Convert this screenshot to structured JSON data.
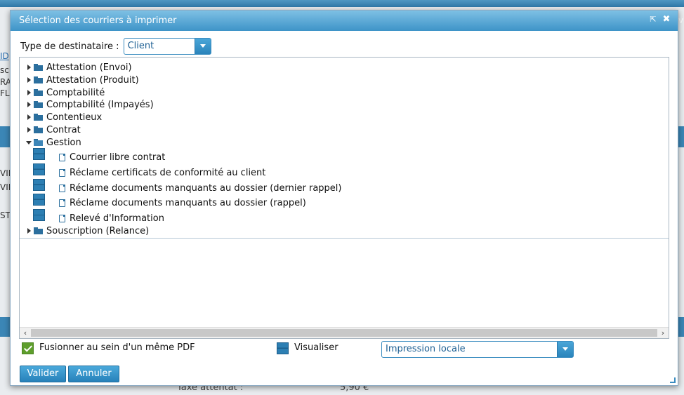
{
  "dialog": {
    "title": "Sélection des courriers à imprimer",
    "type_label": "Type de destinataire :",
    "type_value": "Client"
  },
  "tree": {
    "folders_top": [
      {
        "label": "Attestation (Envoi)"
      },
      {
        "label": "Attestation (Produit)"
      },
      {
        "label": "Comptabilité"
      },
      {
        "label": "Comptabilité (Impayés)"
      },
      {
        "label": "Contentieux"
      },
      {
        "label": "Contrat"
      }
    ],
    "open_folder": {
      "label": "Gestion",
      "children": [
        {
          "label": "Courrier libre contrat"
        },
        {
          "label": "Réclame certificats de conformité au client"
        },
        {
          "label": "Réclame documents manquants au dossier (dernier rappel)"
        },
        {
          "label": "Réclame documents manquants au dossier (rappel)"
        },
        {
          "label": "Relevé d'Information"
        }
      ]
    },
    "folders_bottom": [
      {
        "label": "Souscription (Relance)"
      }
    ]
  },
  "options": {
    "merge_label": "Fusionner au sein d'un même PDF",
    "merge_checked": true,
    "preview_label": "Visualiser",
    "print_mode": "Impression locale"
  },
  "buttons": {
    "validate": "Valider",
    "cancel": "Annuler"
  },
  "background": {
    "link_fragment": "ID",
    "fragments": [
      "sc",
      "RA",
      "FL",
      "VID",
      "VID",
      "ST"
    ],
    "bottom_label": "Taxe attentat :",
    "bottom_value": "5,90 €",
    "right_edge": "v"
  },
  "colors": {
    "title_bar": "#3e94c8",
    "accent": "#2a84bb",
    "check_green": "#5e9e2c"
  }
}
